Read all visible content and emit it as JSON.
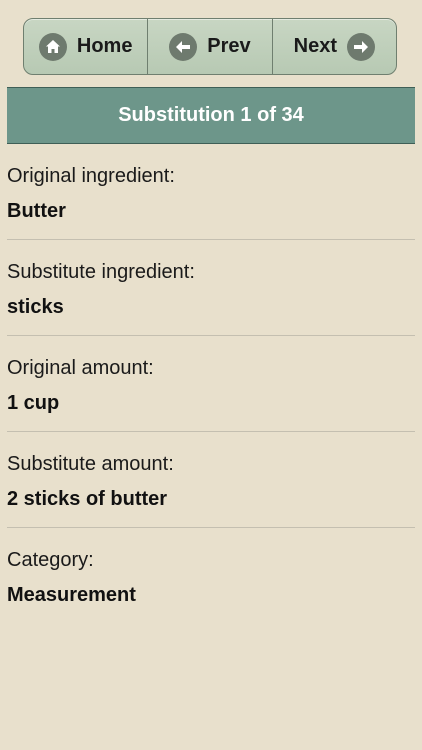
{
  "nav": {
    "home_label": "Home",
    "prev_label": "Prev",
    "next_label": "Next"
  },
  "header": {
    "title": "Substitution 1 of 34"
  },
  "fields": [
    {
      "label": "Original ingredient:",
      "value": "Butter"
    },
    {
      "label": "Substitute ingredient:",
      "value": "sticks"
    },
    {
      "label": "Original amount:",
      "value": "1 cup"
    },
    {
      "label": "Substitute amount:",
      "value": "2 sticks of butter"
    },
    {
      "label": "Category:",
      "value": "Measurement"
    }
  ],
  "colors": {
    "background": "#e8e0cc",
    "nav_bg": "#b7c9b3",
    "header_bg": "#6d968a",
    "icon_bg": "#6e7a6e"
  },
  "icons": {
    "home": "home-icon",
    "prev": "arrow-left-icon",
    "next": "arrow-right-icon"
  }
}
